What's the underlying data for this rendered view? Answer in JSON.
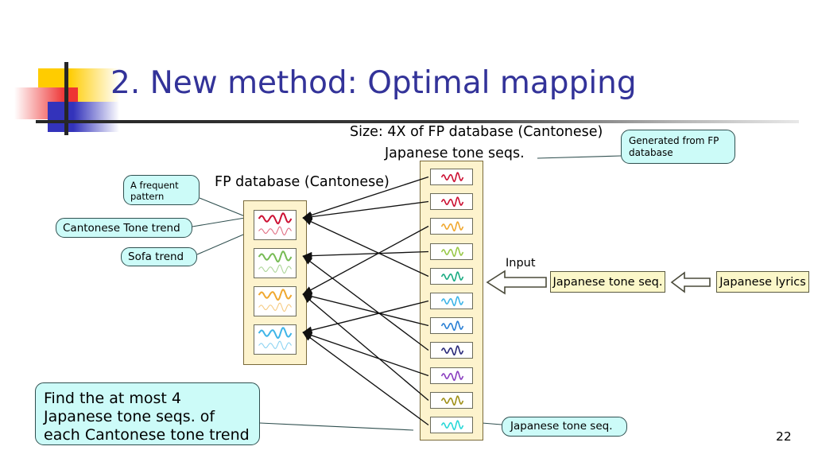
{
  "slide": {
    "title": "2. New method: Optimal mapping",
    "page_number": "22",
    "title_color": "#333399",
    "background_color": "#ffffff"
  },
  "labels": {
    "size_line": "Size: 4X of FP database (Cantonese)",
    "japanese_tone_seqs_line": "Japanese tone seqs.",
    "fp_database_label": "FP database (Cantonese)",
    "input_label": "Input"
  },
  "callouts": {
    "a_frequent_pattern": "A frequent\npattern",
    "a_frequent_pattern_line1": "A frequent",
    "a_frequent_pattern_line2": "pattern",
    "cantonese_tone_trend": "Cantonese Tone trend",
    "sofa_trend": "Sofa trend",
    "generated_from_fp_line1": "Generated from FP",
    "generated_from_fp_line2": "database",
    "find_line1": "Find the at most 4",
    "find_line2": "Japanese tone seqs. of",
    "find_line3": "each Cantonese tone trend",
    "japanese_tone_seq_bottom": "Japanese tone seq.",
    "fill_color": "#ccfbf8",
    "border_color": "#2f4f4f"
  },
  "process_flow": {
    "japanese_tone_seq_box": "Japanese tone seq.",
    "japanese_lyrics_box": "Japanese lyrics",
    "box_fill": "#fbf7c9",
    "box_border": "#5a5a40",
    "arrow_fill": "#ffffff",
    "arrow_border": "#4a4a3a"
  },
  "fp_database": {
    "container_fill": "#fdf3cd",
    "container_border": "#7a6a3a",
    "cell_count": 4,
    "cells": [
      {
        "index": 0,
        "color": "#cc1133",
        "label": "cantonese-tone-trend-1"
      },
      {
        "index": 1,
        "color": "#77bb55",
        "label": "cantonese-tone-trend-2"
      },
      {
        "index": 2,
        "color": "#f0a830",
        "label": "cantonese-tone-trend-3"
      },
      {
        "index": 3,
        "color": "#3fb5e8",
        "label": "cantonese-tone-trend-4"
      }
    ]
  },
  "japanese_tone_seqs": {
    "container_fill": "#fdf3cd",
    "container_border": "#7a6a3a",
    "cell_count": 11,
    "cells": [
      {
        "index": 0,
        "color": "#cc1133",
        "maps_to": 0,
        "label": "japanese-tone-seq-1"
      },
      {
        "index": 1,
        "color": "#cc1133",
        "maps_to": 0,
        "label": "japanese-tone-seq-2"
      },
      {
        "index": 2,
        "color": "#f0a830",
        "maps_to": 2,
        "label": "japanese-tone-seq-3"
      },
      {
        "index": 3,
        "color": "#9ac94a",
        "maps_to": 1,
        "label": "japanese-tone-seq-4"
      },
      {
        "index": 4,
        "color": "#1aab82",
        "maps_to": 0,
        "label": "japanese-tone-seq-5"
      },
      {
        "index": 5,
        "color": "#3fb5e8",
        "maps_to": 3,
        "label": "japanese-tone-seq-6"
      },
      {
        "index": 6,
        "color": "#2a7fd4",
        "maps_to": 2,
        "label": "japanese-tone-seq-7"
      },
      {
        "index": 7,
        "color": "#2a2a7a",
        "maps_to": 1,
        "label": "japanese-tone-seq-8"
      },
      {
        "index": 8,
        "color": "#8a3fc0",
        "maps_to": 3,
        "label": "japanese-tone-seq-9"
      },
      {
        "index": 9,
        "color": "#a09018",
        "maps_to": 2,
        "label": "japanese-tone-seq-10"
      },
      {
        "index": 10,
        "color": "#2ad8d8",
        "maps_to": 3,
        "label": "japanese-tone-seq-11"
      }
    ]
  }
}
